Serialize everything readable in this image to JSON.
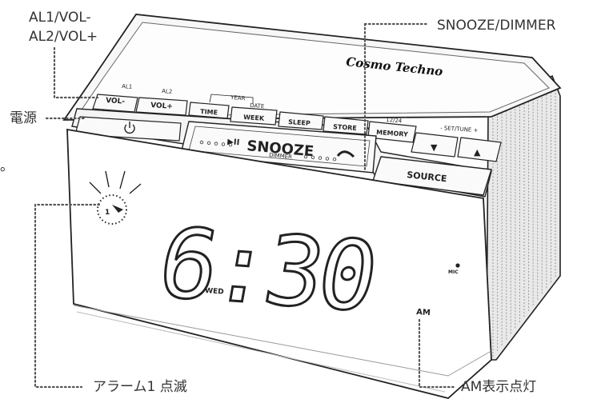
{
  "callouts": {
    "al1_vol": "AL1/VOL-",
    "al2_vol": "AL2/VOL+",
    "snooze_dimmer": "SNOOZE/DIMMER",
    "power": "電源",
    "alarm_blink": "アラーム1 点滅",
    "am_light": "AM表示点灯",
    "period_mark": "。"
  },
  "device": {
    "brand": "Cosmo Techno",
    "buttons": {
      "al1_small": "AL1",
      "vol_minus": "VOL-",
      "al2_small": "AL2",
      "vol_plus": "VOL+",
      "year": "YEAR",
      "time": "TIME",
      "date": "DATE",
      "week": "WEEK",
      "sleep": "SLEEP",
      "store": "STORE",
      "twelve_24": "12/24",
      "memory": "MEMORY",
      "set_tune": "- SET/TUNE +",
      "play_pause": "▶II",
      "snooze": "SNOOZE",
      "dimmer": "DIMMER",
      "source": "SOURCE",
      "down_arrow": "▼",
      "up_arrow": "▲"
    },
    "display": {
      "time": "6:30",
      "day": "WED",
      "ampm": "AM",
      "alarm_indicator": "1"
    },
    "mic_label": "MIC"
  }
}
